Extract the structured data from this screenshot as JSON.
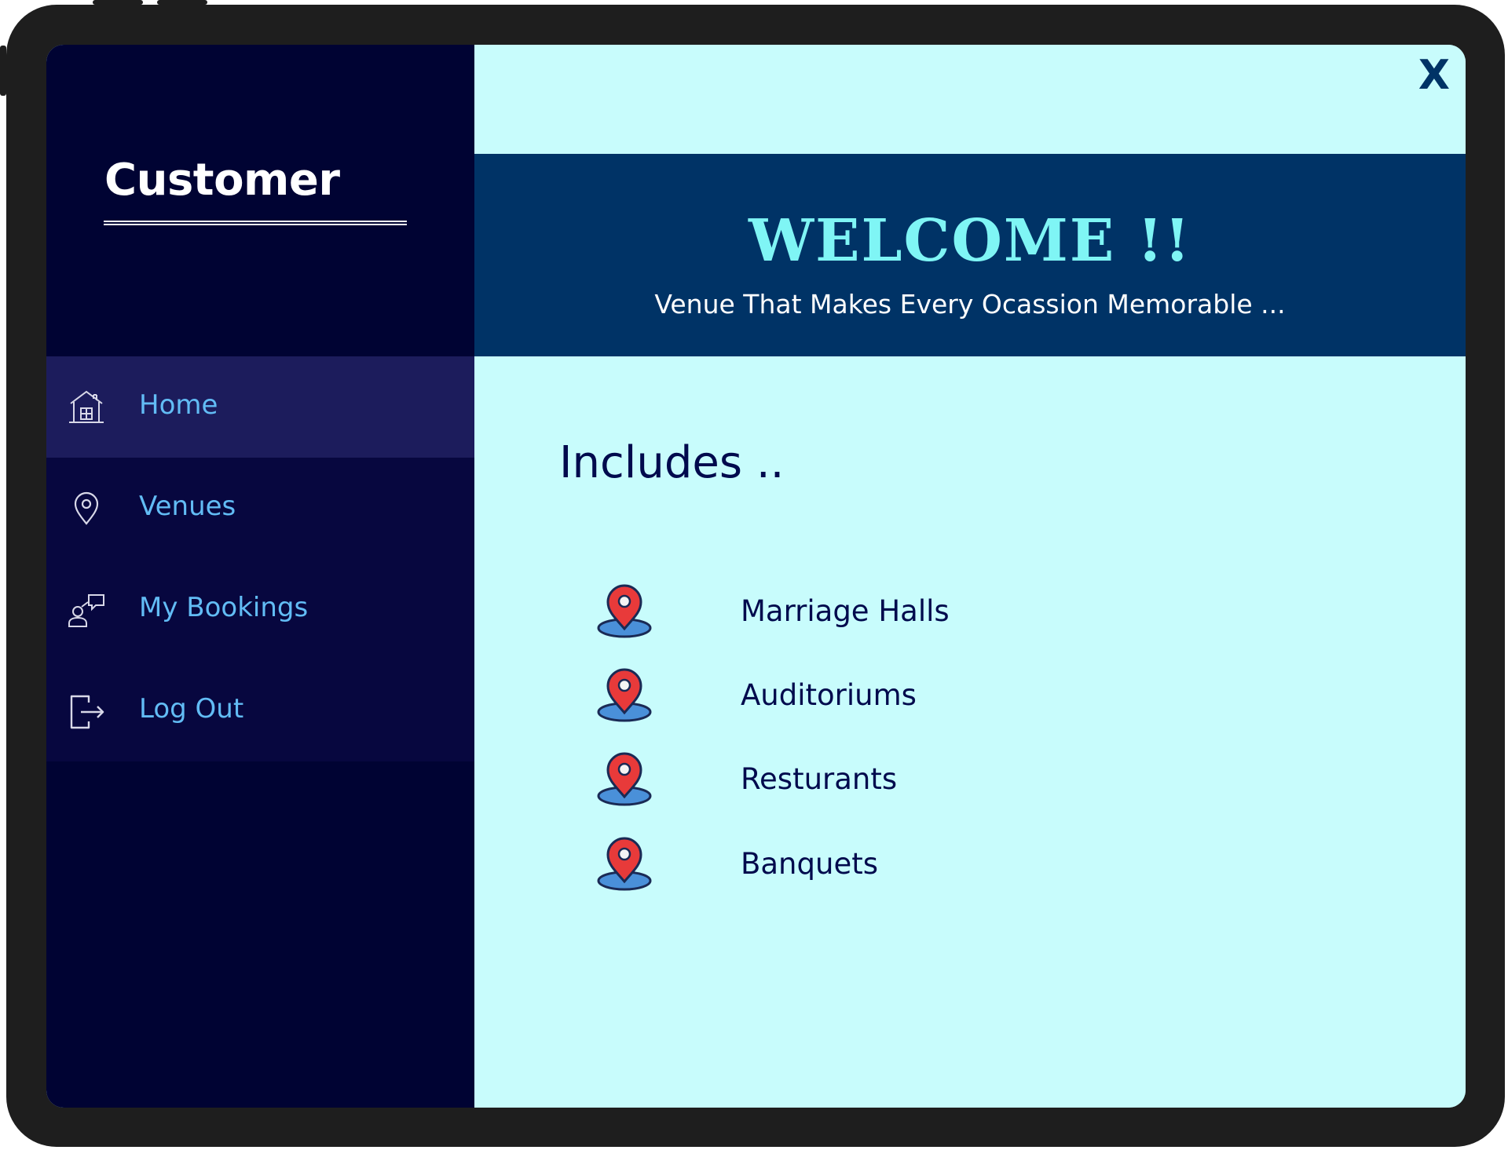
{
  "sidebar": {
    "title": "Customer",
    "items": [
      {
        "label": "Home",
        "icon": "home-icon",
        "active": true
      },
      {
        "label": "Venues",
        "icon": "location-pin-icon",
        "active": false
      },
      {
        "label": "My Bookings",
        "icon": "bookings-icon",
        "active": false
      },
      {
        "label": "Log Out",
        "icon": "logout-icon",
        "active": false
      }
    ]
  },
  "header": {
    "close_label": "X",
    "welcome": "WELCOME !!",
    "tagline": "Venue That Makes Every Ocassion Memorable ..."
  },
  "main": {
    "includes_title": "Includes ..",
    "items": [
      {
        "label": "Marriage Halls",
        "icon": "map-pin-icon"
      },
      {
        "label": "Auditoriums",
        "icon": "map-pin-icon"
      },
      {
        "label": "Resturants",
        "icon": "map-pin-icon"
      },
      {
        "label": "Banquets",
        "icon": "map-pin-icon"
      }
    ]
  },
  "colors": {
    "sidebar_bg": "#000333",
    "nav_bg": "#07073f",
    "nav_active_bg": "#1c1c5c",
    "nav_text": "#62bcf5",
    "banner_bg": "#003366",
    "welcome_text": "#7ff5f5",
    "main_bg": "#c8fcfc",
    "pin_red": "#e83a3a",
    "pin_base": "#4a90d9"
  }
}
